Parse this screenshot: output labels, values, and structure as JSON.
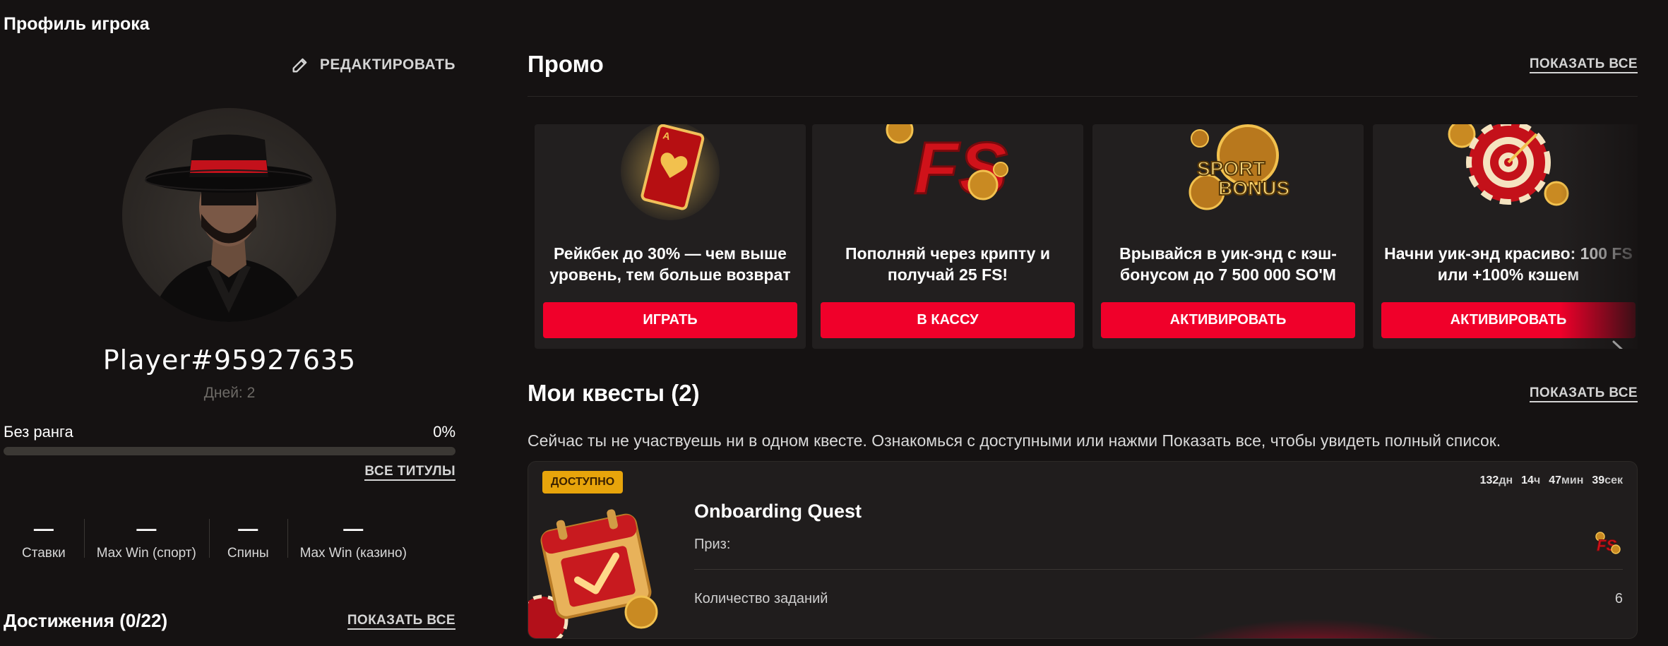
{
  "profile": {
    "page_title": "Профиль игрока",
    "edit_label": "РЕДАКТИРОВАТЬ",
    "player_name": "Player#95927635",
    "days": "Дней: 2",
    "rank": "Без ранга",
    "rank_percent": "0%",
    "rank_progress": 0,
    "all_titles_label": "ВСЕ ТИТУЛЫ",
    "stats": [
      {
        "value": "—",
        "label": "Ставки"
      },
      {
        "value": "—",
        "label": "Max Win (спорт)"
      },
      {
        "value": "—",
        "label": "Спины"
      },
      {
        "value": "—",
        "label": "Max Win (казино)"
      }
    ],
    "achievements_title": "Достижения (0/22)",
    "achievements_show_all": "ПОКАЗАТЬ ВСЕ"
  },
  "promo": {
    "title": "Промо",
    "show_all": "ПОКАЗАТЬ ВСЕ",
    "cards": [
      {
        "text": "Рейкбек до 30% — чем выше уровень, тем больше возврат",
        "button": "ИГРАТЬ",
        "icon": "playing-card-heart-icon"
      },
      {
        "text": "Пополняй через крипту и получай 25 FS!",
        "button": "В КАССУ",
        "icon": "fs-coins-icon"
      },
      {
        "text": "Врывайся в уик-энд с кэш-бонусом до 7 500 000 SO'M",
        "button": "АКТИВИРОВАТЬ",
        "icon": "sport-bonus-icon"
      },
      {
        "text": "Начни уик-энд красиво: 100 FS или +100% кэшем",
        "button": "АКТИВИРОВАТЬ",
        "icon": "target-chip-icon"
      }
    ]
  },
  "quests": {
    "title": "Мои квесты (2)",
    "show_all": "ПОКАЗАТЬ ВСЕ",
    "note": "Сейчас ты не участвуешь ни в одном квесте. Ознакомься с доступными или нажми Показать все, чтобы увидеть полный список.",
    "card": {
      "badge": "ДОСТУПНО",
      "timer": [
        {
          "value": "132",
          "unit": "дн"
        },
        {
          "value": "14",
          "unit": "ч"
        },
        {
          "value": "47",
          "unit": "мин"
        },
        {
          "value": "39",
          "unit": "сек"
        }
      ],
      "title": "Onboarding Quest",
      "prize_label": "Приз:",
      "tasks_label": "Количество заданий",
      "tasks_value": "6"
    }
  },
  "colors": {
    "background": "#151212",
    "accent_red": "#f0002a",
    "badge_gold": "#e7a40b",
    "card_bg": "#221f1f"
  }
}
